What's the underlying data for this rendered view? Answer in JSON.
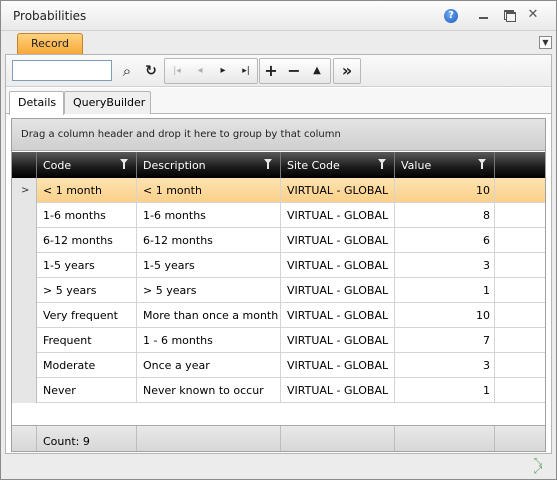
{
  "window": {
    "title": "Probabilities"
  },
  "tabstrip": {
    "record_tab": "Record"
  },
  "toolbar": {
    "search_value": "",
    "search_label": "⌕",
    "refresh_label": "↻",
    "first_label": "|◂",
    "prev_label": "◂",
    "next_label": "▸",
    "last_label": "▸|",
    "add_label": "+",
    "remove_label": "−",
    "up_label": "▲",
    "more_label": "»"
  },
  "detail_tabs": [
    "Details",
    "QueryBuilder"
  ],
  "grid": {
    "group_panel_text": "Drag a column header and drop it here to group by that column",
    "columns": [
      "Code",
      "Description",
      "Site Code",
      "Value"
    ],
    "rows": [
      {
        "code": "< 1 month",
        "description": "< 1 month",
        "site_code": "VIRTUAL - GLOBAL",
        "value": "10",
        "selected": true
      },
      {
        "code": "1-6 months",
        "description": "1-6 months",
        "site_code": "VIRTUAL - GLOBAL",
        "value": "8"
      },
      {
        "code": "6-12 months",
        "description": "6-12 months",
        "site_code": "VIRTUAL - GLOBAL",
        "value": "6"
      },
      {
        "code": "1-5 years",
        "description": "1-5 years",
        "site_code": "VIRTUAL - GLOBAL",
        "value": "3"
      },
      {
        "code": "> 5 years",
        "description": "> 5 years",
        "site_code": "VIRTUAL - GLOBAL",
        "value": "1"
      },
      {
        "code": "Very frequent",
        "description": "More than once a month",
        "site_code": "VIRTUAL - GLOBAL",
        "value": "10"
      },
      {
        "code": "Frequent",
        "description": "1 - 6 months",
        "site_code": "VIRTUAL - GLOBAL",
        "value": "7"
      },
      {
        "code": "Moderate",
        "description": "Once a year",
        "site_code": "VIRTUAL - GLOBAL",
        "value": "3"
      },
      {
        "code": "Never",
        "description": "Never known to occur",
        "site_code": "VIRTUAL - GLOBAL",
        "value": "1"
      }
    ],
    "footer_count": "Count: 9"
  },
  "colors": {
    "selected_row": "#fbd08a",
    "record_tab": "#f7a83a",
    "header_bg": "#1a1a1a"
  }
}
